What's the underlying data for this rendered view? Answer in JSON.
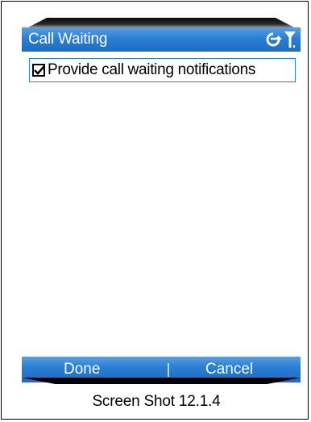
{
  "screen": {
    "title": "Call Waiting",
    "status_icons": [
      "sync-icon",
      "signal-icon"
    ],
    "option": {
      "label": "Provide call waiting notifications",
      "checked": true
    },
    "soft_keys": {
      "left": "Done",
      "right": "Cancel"
    }
  },
  "caption": "Screen Shot 12.1.4",
  "colors": {
    "title_bar": "#2a7fd4",
    "soft_keys": "#2a7fd4",
    "focus_border": "#2a7fd4"
  }
}
